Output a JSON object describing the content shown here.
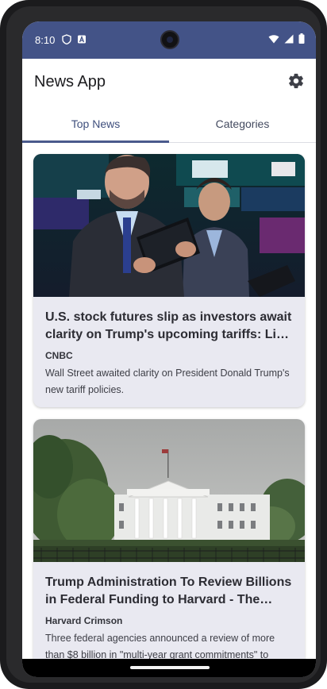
{
  "status_bar": {
    "time": "8:10",
    "left_icons": [
      "shield-icon",
      "a-badge-icon"
    ],
    "right_icons": [
      "wifi-icon",
      "signal-icon",
      "battery-icon"
    ]
  },
  "app_bar": {
    "title": "News App",
    "settings_icon": "gear-icon"
  },
  "tabs": [
    {
      "label": "Top News",
      "selected": true
    },
    {
      "label": "Categories",
      "selected": false
    }
  ],
  "articles": [
    {
      "title": "U.S. stock futures slip as investors await clarity on Trump's upcoming tariffs: Live updates",
      "source": "CNBC",
      "description": "Wall Street awaited clarity on President Donald Trump's new tariff policies.",
      "image": "stock-exchange-traders-photo"
    },
    {
      "title": "Trump Administration To Review Billions in Federal Funding to Harvard - The Harvard Crimson",
      "source": "Harvard Crimson",
      "description": "Three federal agencies announced a review of more than $8 billion in \"multi-year grant commitments\" to",
      "image": "white-house-photo"
    }
  ],
  "colors": {
    "status_bar": "#435387",
    "accent": "#4a5a8c",
    "card_background": "#e9e9f1"
  }
}
